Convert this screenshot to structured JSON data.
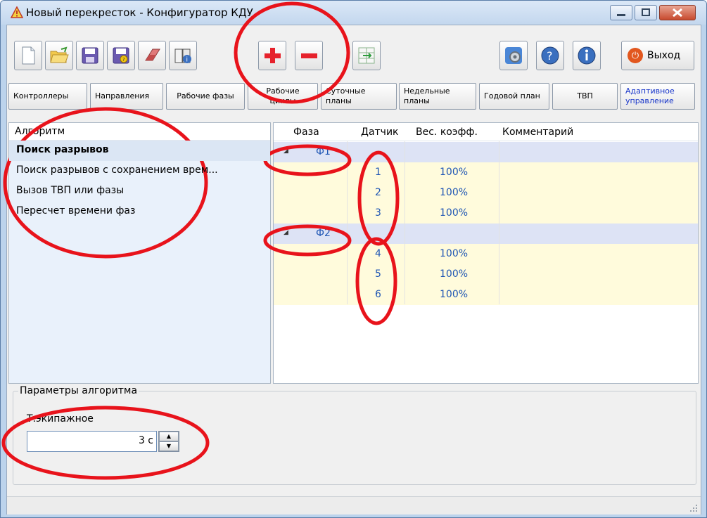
{
  "window": {
    "title": "Новый перекресток - Конфигуратор КДУ"
  },
  "toolbar": {
    "icons": [
      "new-file-icon",
      "open-folder-icon",
      "save-icon",
      "save-as-icon",
      "eraser-icon",
      "book-info-icon",
      "plus-icon",
      "minus-icon",
      "grid-split-icon",
      "settings-icon",
      "help-icon",
      "info-icon",
      "power-icon"
    ],
    "exit_label": "Выход"
  },
  "tabs": [
    {
      "label": "Контроллеры"
    },
    {
      "label": "Направления"
    },
    {
      "label": "Рабочие фазы"
    },
    {
      "label": "Рабочие циклы"
    },
    {
      "label": "Суточные планы"
    },
    {
      "label": "Недельные планы"
    },
    {
      "label": "Годовой план"
    },
    {
      "label": "ТВП"
    },
    {
      "label": "Адаптивное управление",
      "active": true
    }
  ],
  "algorithms": {
    "header": "Алгоритм",
    "items": [
      {
        "label": "Поиск разрывов",
        "selected": true
      },
      {
        "label": "Поиск разрывов с сохранением врем..."
      },
      {
        "label": "Вызов ТВП или фазы"
      },
      {
        "label": "Пересчет времени фаз"
      }
    ]
  },
  "grid": {
    "columns": [
      "Фаза",
      "Датчик",
      "Вес. коэфф.",
      "Комментарий"
    ],
    "groups": [
      {
        "phase": "Ф1",
        "rows": [
          {
            "sensor": "1",
            "weight": "100%"
          },
          {
            "sensor": "2",
            "weight": "100%"
          },
          {
            "sensor": "3",
            "weight": "100%"
          }
        ]
      },
      {
        "phase": "Ф2",
        "rows": [
          {
            "sensor": "4",
            "weight": "100%"
          },
          {
            "sensor": "5",
            "weight": "100%"
          },
          {
            "sensor": "6",
            "weight": "100%"
          }
        ]
      }
    ]
  },
  "params": {
    "title": "Параметры алгоритма",
    "label": "Т.экипажное",
    "value": "3 с"
  },
  "colors": {
    "annotation": "#e8131b",
    "link_text": "#1f56b4",
    "group_row": "#dde3f5",
    "data_row": "#fffbdc"
  }
}
